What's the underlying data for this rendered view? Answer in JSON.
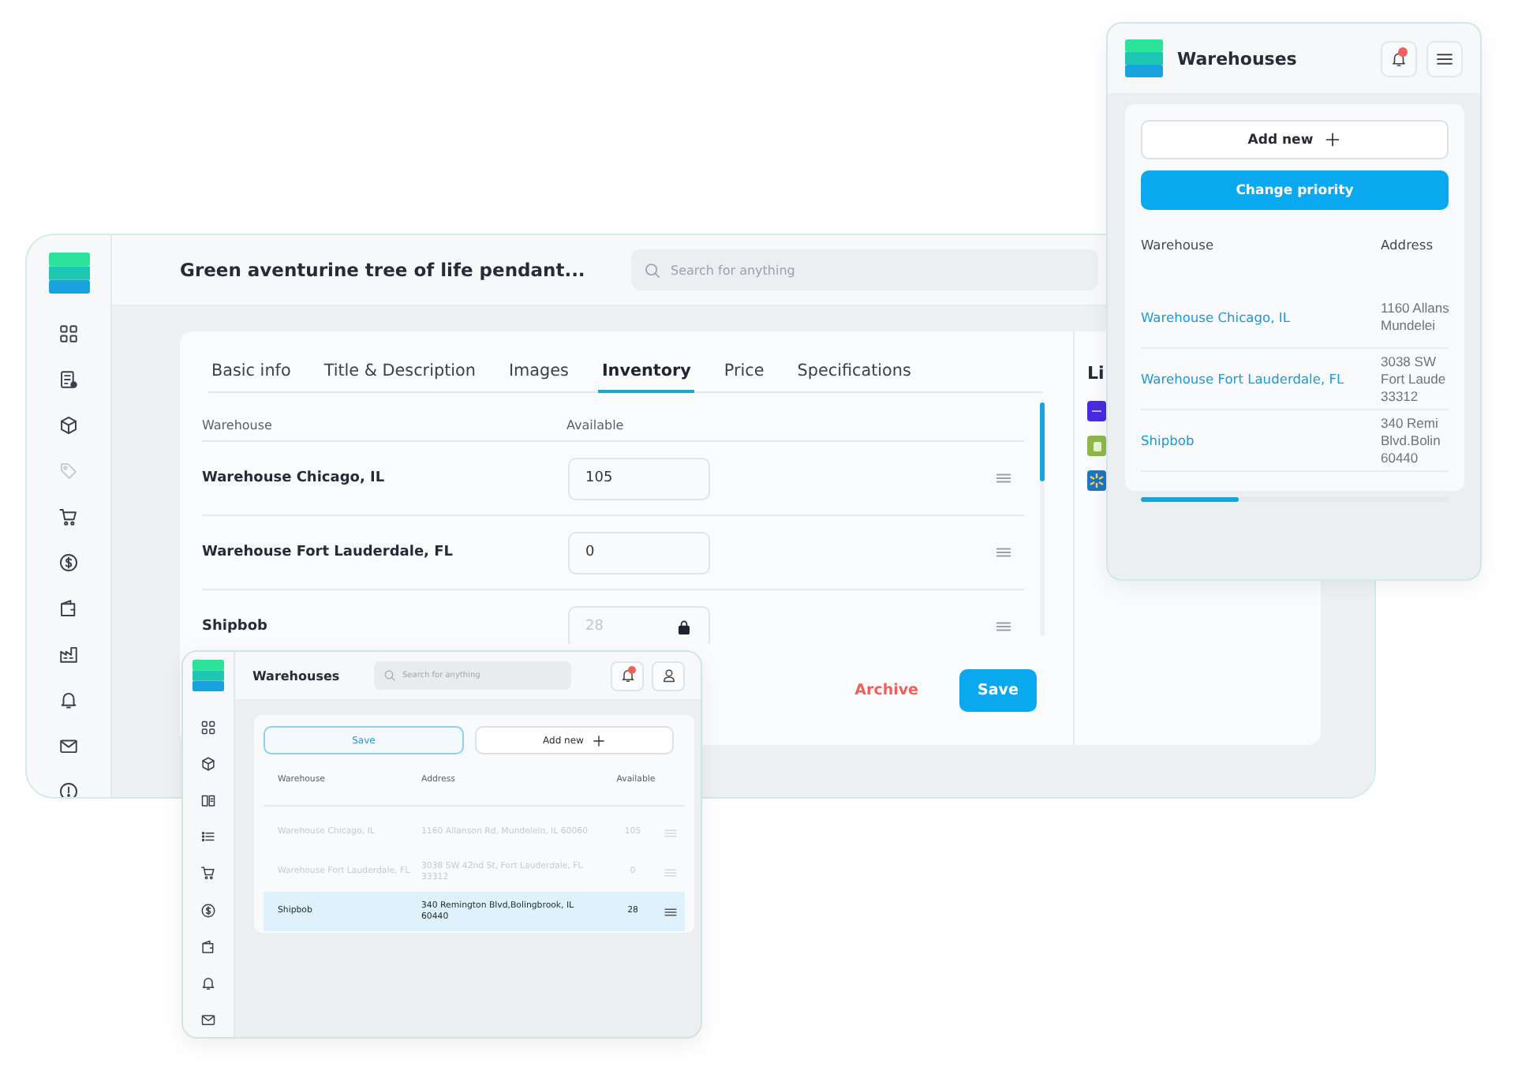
{
  "main_window": {
    "title": "Green aventurine tree of life pendant...",
    "search": {
      "placeholder": "Search for anything"
    },
    "sidebar": {
      "items": [
        {
          "disabled": false
        },
        {
          "disabled": false
        },
        {
          "disabled": false
        },
        {
          "disabled": true
        },
        {
          "disabled": false
        },
        {
          "disabled": false
        },
        {
          "disabled": false
        },
        {
          "disabled": false
        },
        {
          "disabled": false
        },
        {
          "disabled": false
        },
        {
          "disabled": false
        }
      ]
    },
    "tabs": [
      {
        "label": "Basic info",
        "selected": false
      },
      {
        "label": "Title & Description",
        "selected": false
      },
      {
        "label": "Images",
        "selected": false
      },
      {
        "label": "Inventory",
        "selected": true
      },
      {
        "label": "Price",
        "selected": false
      },
      {
        "label": "Specifications",
        "selected": false
      }
    ],
    "table": {
      "columns": [
        "Warehouse",
        "Available"
      ],
      "rows": [
        {
          "warehouse": "Warehouse Chicago, IL",
          "available": "105",
          "locked": false
        },
        {
          "warehouse": "Warehouse Fort Lauderdale, FL",
          "available": "0",
          "locked": false
        },
        {
          "warehouse": "Shipbob",
          "available": "28",
          "locked": true
        }
      ]
    },
    "actions": [
      {
        "label": "Archive",
        "kind": "danger"
      },
      {
        "label": "Save",
        "kind": "primary"
      }
    ],
    "side_section": {
      "title": "Li"
    }
  },
  "warehouses_panel": {
    "title": "Warehouses",
    "buttons": [
      {
        "label": "Add new",
        "kind": "outline"
      },
      {
        "label": "Change priority",
        "kind": "primary"
      }
    ],
    "columns": [
      "Warehouse",
      "Address"
    ],
    "rows": [
      {
        "warehouse": "Warehouse Chicago, IL",
        "address": [
          "1160 Allans",
          "Mundelei"
        ]
      },
      {
        "warehouse": "Warehouse Fort Lauderdale, FL",
        "address": [
          "3038 SW",
          "Fort Laude",
          "33312"
        ]
      },
      {
        "warehouse": "Shipbob",
        "address": [
          "340 Remi",
          "Blvd.Bolin",
          "60440"
        ]
      }
    ],
    "scroll": {
      "level": 0.32
    }
  },
  "mini_window": {
    "title": "Warehouses",
    "search": {
      "placeholder": "Search for anything"
    },
    "buttons": [
      {
        "label": "Save",
        "kind": "accent"
      },
      {
        "label": "Add new",
        "kind": "outline"
      }
    ],
    "columns": [
      "Warehouse",
      "Address",
      "Available"
    ],
    "rows": [
      {
        "warehouse": "Warehouse Chicago, IL",
        "address": "1160 Allanson Rd, Mundelein, IL 60060",
        "available": "105",
        "selected": false
      },
      {
        "warehouse": "Warehouse Fort Lauderdale, FL",
        "address": "3038 SW 42nd St, Fort Lauderdale, FL 33312",
        "available": "0",
        "selected": false
      },
      {
        "warehouse": "Shipbob",
        "address": "340 Remington Blvd,Bolingbrook, IL 60440",
        "available": "28",
        "selected": true
      }
    ]
  }
}
